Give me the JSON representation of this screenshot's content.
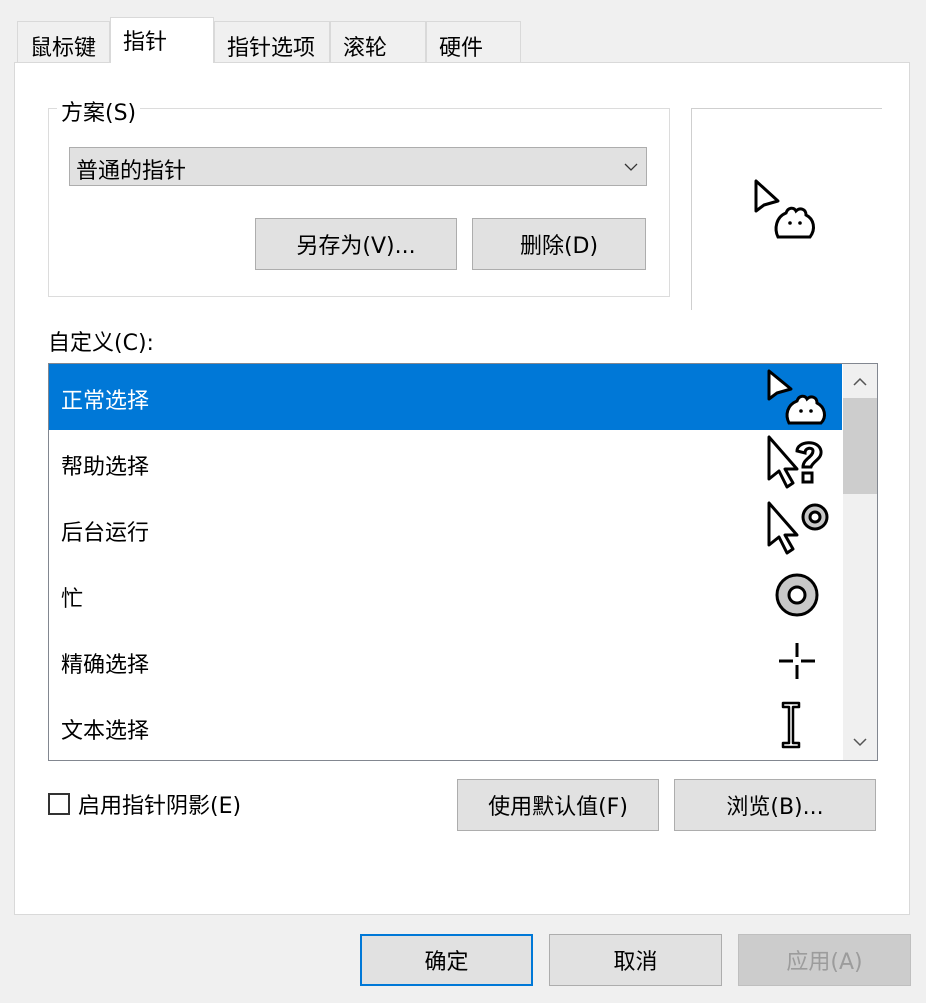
{
  "tabs": [
    {
      "label": "鼠标键",
      "active": false
    },
    {
      "label": "指针",
      "active": true
    },
    {
      "label": "指针选项",
      "active": false
    },
    {
      "label": "滚轮",
      "active": false
    },
    {
      "label": "硬件",
      "active": false
    }
  ],
  "scheme": {
    "legend": "方案(S)",
    "selected": "普通的指针",
    "save_as_button": "另存为(V)...",
    "delete_button": "删除(D)"
  },
  "customize": {
    "label": "自定义(C):",
    "items": [
      {
        "label": "正常选择",
        "icon": "hamster-arrow-cursor-icon",
        "selected": true
      },
      {
        "label": "帮助选择",
        "icon": "help-cursor-icon",
        "selected": false
      },
      {
        "label": "后台运行",
        "icon": "working-in-background-cursor-icon",
        "selected": false
      },
      {
        "label": "忙",
        "icon": "busy-cursor-icon",
        "selected": false
      },
      {
        "label": "精确选择",
        "icon": "crosshair-cursor-icon",
        "selected": false
      },
      {
        "label": "文本选择",
        "icon": "ibeam-cursor-icon",
        "selected": false
      }
    ]
  },
  "shadow_checkbox": {
    "label": "启用指针阴影(E)",
    "checked": false
  },
  "use_default_button": "使用默认值(F)",
  "browse_button": "浏览(B)...",
  "footer": {
    "ok": "确定",
    "cancel": "取消",
    "apply": "应用(A)"
  },
  "colors": {
    "selection": "#0078d7",
    "default_button_border": "#0078d7"
  }
}
